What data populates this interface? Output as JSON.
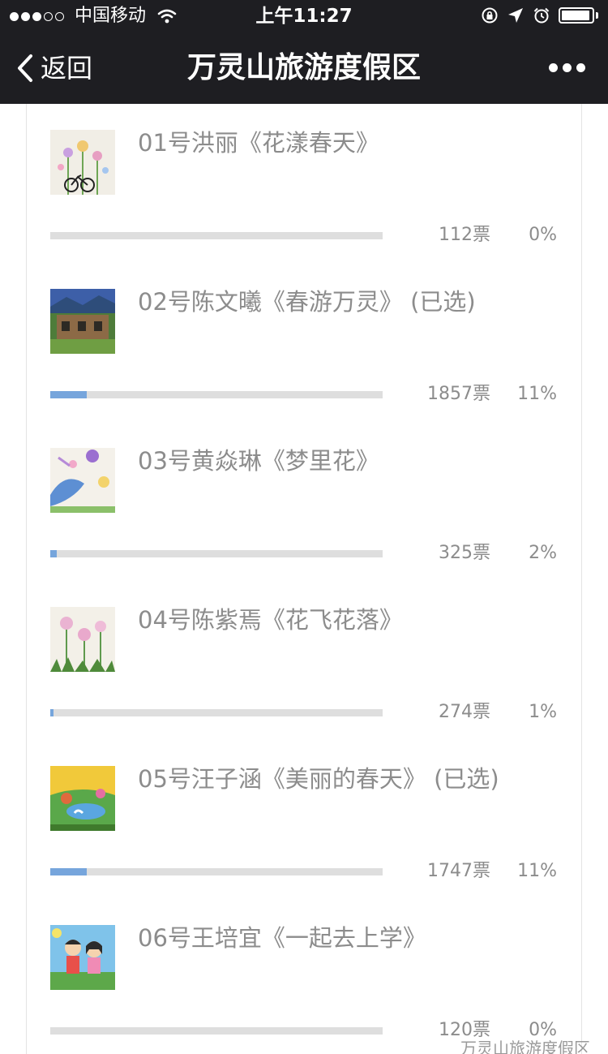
{
  "status_bar": {
    "carrier": "中国移动",
    "time": "上午11:27",
    "signal_filled": 3,
    "signal_total": 5
  },
  "nav": {
    "back_label": "返回",
    "title": "万灵山旅游度假区"
  },
  "entries": [
    {
      "title": "01号洪丽《花漾春天》",
      "votes": "112票",
      "percent": "0%",
      "fill": 0.0
    },
    {
      "title": "02号陈文曦《春游万灵》 (已选)",
      "votes": "1857票",
      "percent": "11%",
      "fill": 0.11
    },
    {
      "title": "03号黄焱琳《梦里花》",
      "votes": "325票",
      "percent": "2%",
      "fill": 0.02
    },
    {
      "title": "04号陈紫焉《花飞花落》",
      "votes": "274票",
      "percent": "1%",
      "fill": 0.01
    },
    {
      "title": "05号汪子涵《美丽的春天》 (已选)",
      "votes": "1747票",
      "percent": "11%",
      "fill": 0.11
    },
    {
      "title": "06号王培宜《一起去上学》",
      "votes": "120票",
      "percent": "0%",
      "fill": 0.0
    }
  ],
  "watermark": "万灵山旅游度假区",
  "colors": {
    "header_bg": "#1e1e22",
    "bar_fill": "#76a5dc",
    "bar_track": "#dedede",
    "text_gray": "#8c8c8c"
  }
}
